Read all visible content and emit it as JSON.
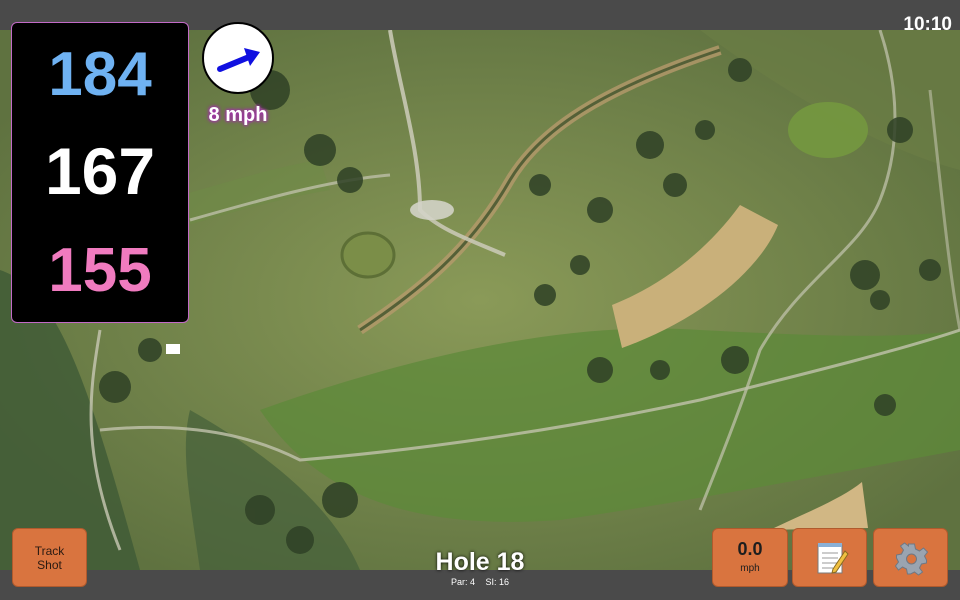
{
  "status": {
    "time": "10:10"
  },
  "yardages": {
    "back": "184",
    "middle": "167",
    "front": "155"
  },
  "wind": {
    "speed_label": "8 mph",
    "direction_icon": "arrow-icon",
    "arrow_color": "#1010e0"
  },
  "hole": {
    "title": "Hole 18",
    "par": "Par: 4",
    "stroke_index": "SI: 16"
  },
  "buttons": {
    "track_shot": {
      "line1": "Track",
      "line2": "Shot"
    },
    "speed": {
      "value": "0.0",
      "unit": "mph"
    },
    "notes_icon": "notepad-icon",
    "settings_icon": "gear-icon"
  },
  "colors": {
    "back_yardage": "#6fb2f2",
    "middle_yardage": "#ffffff",
    "front_yardage": "#f07bbf",
    "button": "#d9743f"
  }
}
